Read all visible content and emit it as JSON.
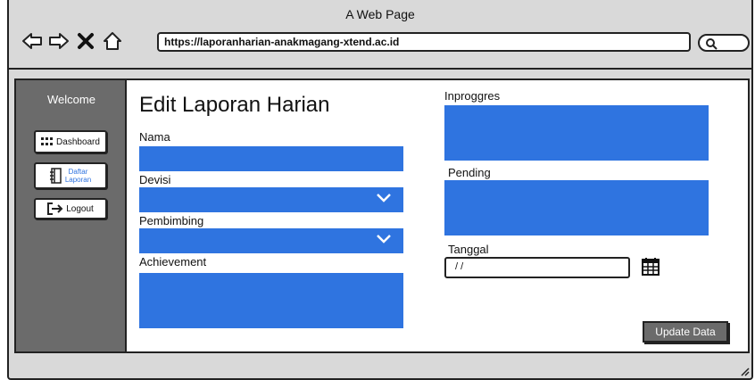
{
  "window": {
    "title": "A Web Page"
  },
  "browser": {
    "url": "https://laporanharian-anakmagang-xtend.ac.id",
    "icons": [
      "back-arrow-icon",
      "forward-arrow-icon",
      "close-x-icon",
      "home-icon",
      "search-icon"
    ]
  },
  "sidebar": {
    "title": "Welcome",
    "items": [
      {
        "label": "Dashboard",
        "icon": "grid-icon",
        "active": false
      },
      {
        "label_line1": "Daftar",
        "label_line2": "Laporan",
        "icon": "notebook-icon",
        "active": true
      },
      {
        "label": "Logout",
        "icon": "logout-arrow-icon",
        "active": false
      }
    ]
  },
  "form": {
    "title": "Edit Laporan Harian",
    "nama_label": "Nama",
    "nama_value": "",
    "devisi_label": "Devisi",
    "devisi_value": "",
    "pembimbing_label": "Pembimbing",
    "pembimbing_value": "",
    "achievement_label": "Achievement",
    "achievement_value": "",
    "inproggres_label": "Inproggres",
    "inproggres_value": "",
    "pending_label": "Pending",
    "pending_value": "",
    "tanggal_label": "Tanggal",
    "tanggal_value": "/ /",
    "update_button": "Update Data"
  },
  "colors": {
    "accent": "#2f74e0",
    "sidebar": "#6b6b6b",
    "chrome": "#d9d9d9"
  }
}
